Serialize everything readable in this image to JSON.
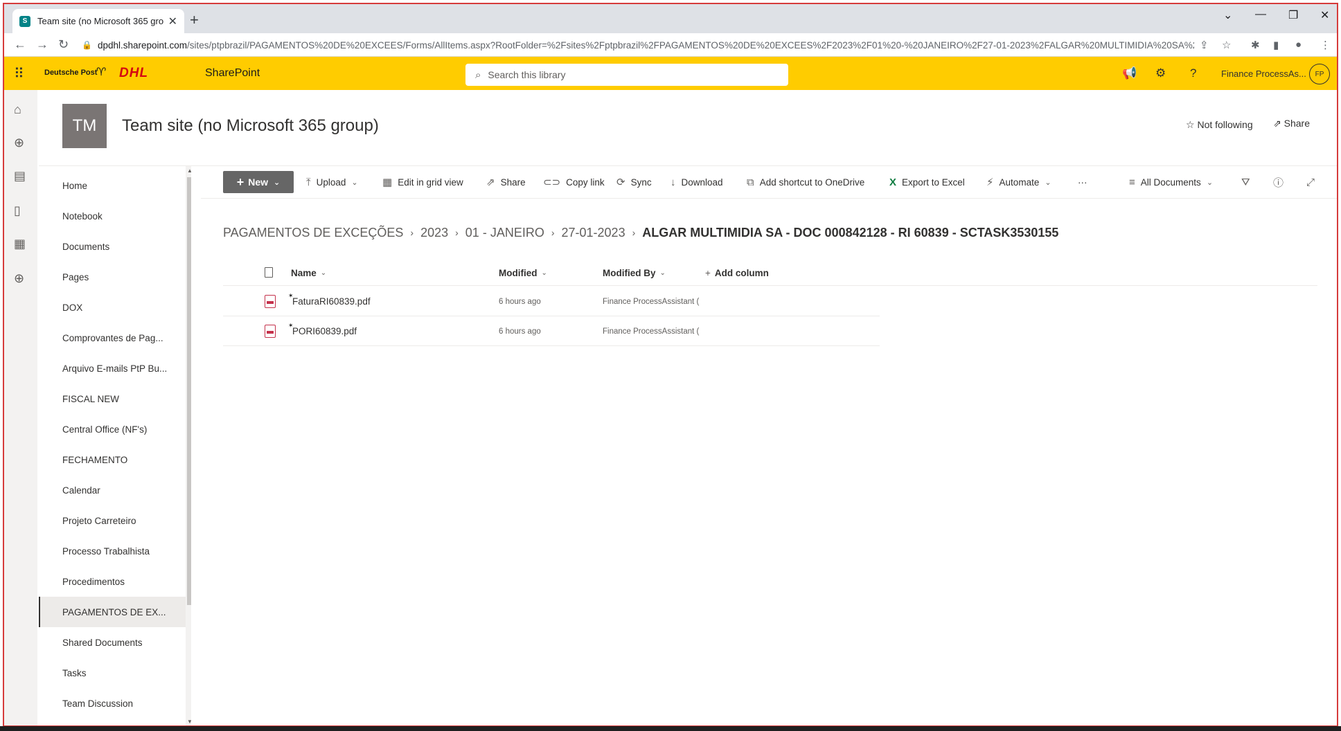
{
  "browser": {
    "tab_title": "Team site (no Microsoft 365 grou",
    "tab_favicon": "S",
    "url_host": "dpdhl.sharepoint.com",
    "url_path": "/sites/ptpbrazil/PAGAMENTOS%20DE%20EXCEES/Forms/AllItems.aspx?RootFolder=%2Fsites%2Fptpbrazil%2FPAGAMENTOS%20DE%20EXCEES%2F2023%2F01%20-%20JANEIRO%2F27-01-2023%2FALGAR%20MULTIMIDIA%20SA%2..."
  },
  "suitebar": {
    "brand_deutsche_post": "Deutsche Post",
    "brand_dhl": "DHL",
    "app_name": "SharePoint",
    "search_placeholder": "Search this library",
    "user_name": "Finance ProcessAs...",
    "user_initials": "FP",
    "color": "#ffcc00"
  },
  "site": {
    "logo_initials": "TM",
    "title": "Team site (no Microsoft 365 group)",
    "follow_label": "Not following",
    "share_label": "Share"
  },
  "nav": {
    "items": [
      {
        "label": "Home"
      },
      {
        "label": "Notebook"
      },
      {
        "label": "Documents"
      },
      {
        "label": "Pages"
      },
      {
        "label": "DOX"
      },
      {
        "label": "Comprovantes de Pag..."
      },
      {
        "label": "Arquivo E-mails PtP Bu..."
      },
      {
        "label": "FISCAL NEW"
      },
      {
        "label": "Central Office (NF's)"
      },
      {
        "label": "FECHAMENTO"
      },
      {
        "label": "Calendar"
      },
      {
        "label": "Projeto Carreteiro"
      },
      {
        "label": "Processo Trabalhista"
      },
      {
        "label": "Procedimentos"
      },
      {
        "label": "PAGAMENTOS DE EX..."
      },
      {
        "label": "Shared Documents"
      },
      {
        "label": "Tasks"
      },
      {
        "label": "Team Discussion"
      }
    ],
    "selected_index": 14
  },
  "commands": {
    "new": "New",
    "upload": "Upload",
    "edit_grid": "Edit in grid view",
    "share": "Share",
    "copy_link": "Copy link",
    "sync": "Sync",
    "download": "Download",
    "add_shortcut": "Add shortcut to OneDrive",
    "export_excel": "Export to Excel",
    "automate": "Automate",
    "more": "···",
    "view": "All Documents"
  },
  "breadcrumb": {
    "items": [
      "PAGAMENTOS DE EXCEÇÕES",
      "2023",
      "01 - JANEIRO",
      "27-01-2023"
    ],
    "current": "ALGAR MULTIMIDIA SA - DOC 000842128 - RI 60839 - SCTASK3530155"
  },
  "list": {
    "columns": {
      "name": "Name",
      "modified": "Modified",
      "modified_by": "Modified By",
      "add_column": "Add column"
    },
    "rows": [
      {
        "name": "FaturaRI60839.pdf",
        "modified": "6 hours ago",
        "modified_by": "Finance ProcessAssistant ("
      },
      {
        "name": "PORI60839.pdf",
        "modified": "6 hours ago",
        "modified_by": "Finance ProcessAssistant ("
      }
    ]
  }
}
